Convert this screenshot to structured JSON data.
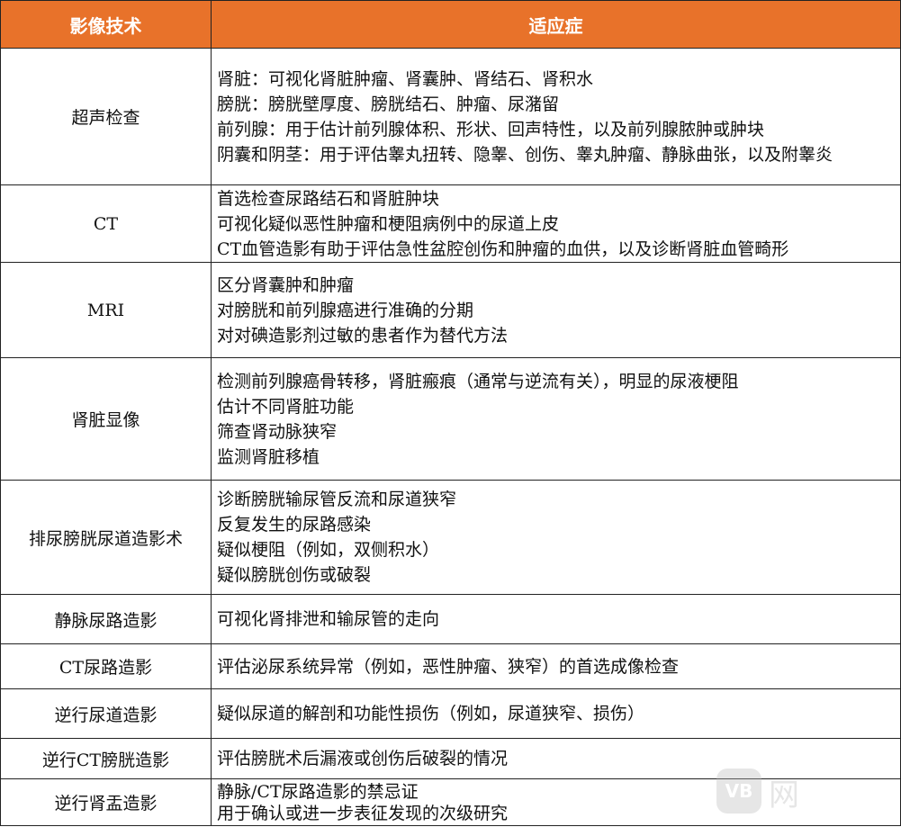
{
  "table": {
    "headers": [
      "影像技术",
      "适应症"
    ],
    "rows": [
      {
        "technique": "超声检查",
        "indications": [
          "肾脏：可视化肾脏肿瘤、肾囊肿、肾结石、肾积水",
          "膀胱：膀胱壁厚度、膀胱结石、肿瘤、尿潴留",
          "前列腺：用于估计前列腺体积、形状、回声特性，以及前列腺脓肿或肿块",
          "阴囊和阴茎：用于评估睾丸扭转、隐睾、创伤、睾丸肿瘤、静脉曲张，以及附睾炎"
        ]
      },
      {
        "technique": "CT",
        "indications": [
          "首选检查尿路结石和肾脏肿块",
          "可视化疑似恶性肿瘤和梗阻病例中的尿道上皮",
          "CT血管造影有助于评估急性盆腔创伤和肿瘤的血供，以及诊断肾脏血管畸形"
        ]
      },
      {
        "technique": "MRI",
        "indications": [
          "区分肾囊肿和肿瘤",
          "对膀胱和前列腺癌进行准确的分期",
          "对对碘造影剂过敏的患者作为替代方法"
        ]
      },
      {
        "technique": "肾脏显像",
        "indications": [
          "检测前列腺癌骨转移，肾脏瘢痕（通常与逆流有关），明显的尿液梗阻",
          "估计不同肾脏功能",
          "筛查肾动脉狭窄",
          "监测肾脏移植"
        ]
      },
      {
        "technique": "排尿膀胱尿道造影术",
        "indications": [
          "诊断膀胱输尿管反流和尿道狭窄",
          "反复发生的尿路感染",
          "疑似梗阻（例如，双侧积水）",
          "疑似膀胱创伤或破裂"
        ]
      },
      {
        "technique": "静脉尿路造影",
        "indications": [
          "可视化肾排泄和输尿管的走向"
        ]
      },
      {
        "technique": "CT尿路造影",
        "indications": [
          "评估泌尿系统异常（例如，恶性肿瘤、狭窄）的首选成像检查"
        ]
      },
      {
        "technique": "逆行尿道造影",
        "indications": [
          "疑似尿道的解剖和功能性损伤（例如，尿道狭窄、损伤）"
        ]
      },
      {
        "technique": "逆行CT膀胱造影",
        "indications": [
          "评估膀胱术后漏液或创伤后破裂的情况"
        ]
      },
      {
        "technique": "逆行肾盂造影",
        "indications": [
          "静脉/CT尿路造影的禁忌证",
          "用于确认或进一步表征发现的次级研究"
        ]
      }
    ]
  },
  "watermark": {
    "badge": "VB",
    "text": "网"
  },
  "colors": {
    "header_bg": "#e8722a",
    "header_text": "#ffffff",
    "border": "#222222"
  }
}
